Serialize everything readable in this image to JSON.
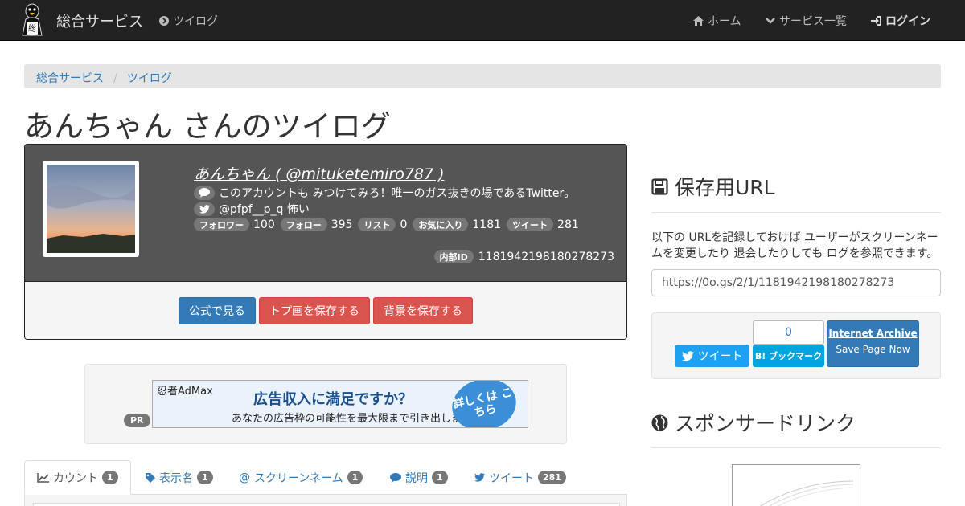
{
  "navbar": {
    "brand": "総合サービス",
    "tsuilog": "ツイログ",
    "home": "ホーム",
    "services": "サービス一覧",
    "login": "ログイン"
  },
  "breadcrumb": [
    "総合サービス",
    "ツイログ"
  ],
  "page_title": "あんちゃん さんのツイログ",
  "profile": {
    "name": "あんちゃん ( @mituketemiro787 )",
    "bio": "このアカウントも みつけてみろ！唯一のガス抜きの場であるTwitter。",
    "twitter_line": "@pfpf__p_q 怖い",
    "stats": [
      {
        "label": "フォロワー",
        "value": "100"
      },
      {
        "label": "フォロー",
        "value": "395"
      },
      {
        "label": "リスト",
        "value": "0"
      },
      {
        "label": "お気に入り",
        "value": "1181"
      },
      {
        "label": "ツイート",
        "value": "281"
      }
    ],
    "internal_id_label": "内部ID",
    "internal_id": "1181942198180278273",
    "buttons": {
      "official": "公式で見る",
      "save_icon": "トプ画を保存する",
      "save_bg": "背景を保存する"
    }
  },
  "ad": {
    "pr": "PR",
    "logo": "忍者AdMax",
    "headline": "広告収入に満足ですか？",
    "sub": "あなたの広告枠の可能性を最大限まで引き出します",
    "circle": "詳しくは こちら"
  },
  "tabs": [
    {
      "label": "カウント",
      "count": "1",
      "icon": "line-chart-icon"
    },
    {
      "label": "表示名",
      "count": "1",
      "icon": "tag-icon"
    },
    {
      "label": "スクリーンネーム",
      "count": "1",
      "icon": "at-icon"
    },
    {
      "label": "説明",
      "count": "1",
      "icon": "comment-icon"
    },
    {
      "label": "ツイート",
      "count": "281",
      "icon": "twitter-icon"
    }
  ],
  "side": {
    "save_url_heading": "保存用URL",
    "desc": "以下の URLを記録しておけば ユーザーがスクリーンネームを変更したり 退会したりしても ログを参照できます。",
    "url": "https://0o.gs/2/1/1181942198180278273",
    "tweet_btn": "ツイート",
    "hatena_count": "0",
    "hatena_btn": "B! ブックマーク",
    "ia_title": "Internet Archive",
    "ia_sub": "Save Page Now",
    "sponsor_heading": "スポンサードリンク"
  },
  "colors": {
    "navbar_bg": "#222222",
    "link": "#337ab7",
    "danger": "#d9534f",
    "profile_bg": "#555555",
    "twitter": "#1da1f2",
    "hatena": "#00a4de"
  }
}
